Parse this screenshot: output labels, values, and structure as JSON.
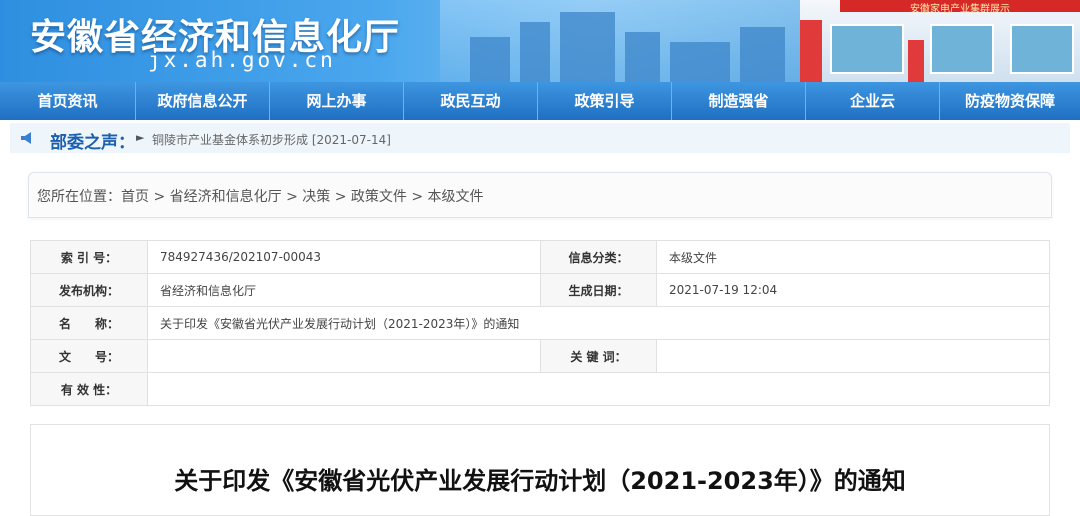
{
  "header": {
    "title": "安徽省经济和信息化厅",
    "url": "jx.ah.gov.cn",
    "booth_sign": "安徽家电产业集群展示"
  },
  "nav": {
    "items": [
      "首页资讯",
      "政府信息公开",
      "网上办事",
      "政民互动",
      "政策引导",
      "制造强省",
      "企业云",
      "防疫物资保障"
    ]
  },
  "notice": {
    "label": "部委之声：",
    "text": "铜陵市产业基金体系初步形成 [2021-07-14]"
  },
  "breadcrumb": {
    "text": "您所在位置：首页 > 省经济和信息化厅 > 决策 > 政策文件 > 本级文件"
  },
  "info": {
    "index_label": "索 引 号：",
    "index_value": "784927436/202107-00043",
    "category_label": "信息分类：",
    "category_value": "本级文件",
    "publisher_label": "发布机构：",
    "publisher_value": "省经济和信息化厅",
    "date_label": "生成日期：",
    "date_value": "2021-07-19 12:04",
    "name_label": "名　　称：",
    "name_value": "关于印发《安徽省光伏产业发展行动计划（2021-2023年）》的通知",
    "docno_label": "文　　号：",
    "docno_value": "",
    "keywords_label": "关 键 词：",
    "keywords_value": "",
    "validity_label": "有 效 性：",
    "validity_value": ""
  },
  "article": {
    "title": "关于印发《安徽省光伏产业发展行动计划（2021-2023年）》的通知"
  },
  "colors": {
    "nav_blue": "#2a7fd2",
    "title_blue": "#1c5fae"
  }
}
